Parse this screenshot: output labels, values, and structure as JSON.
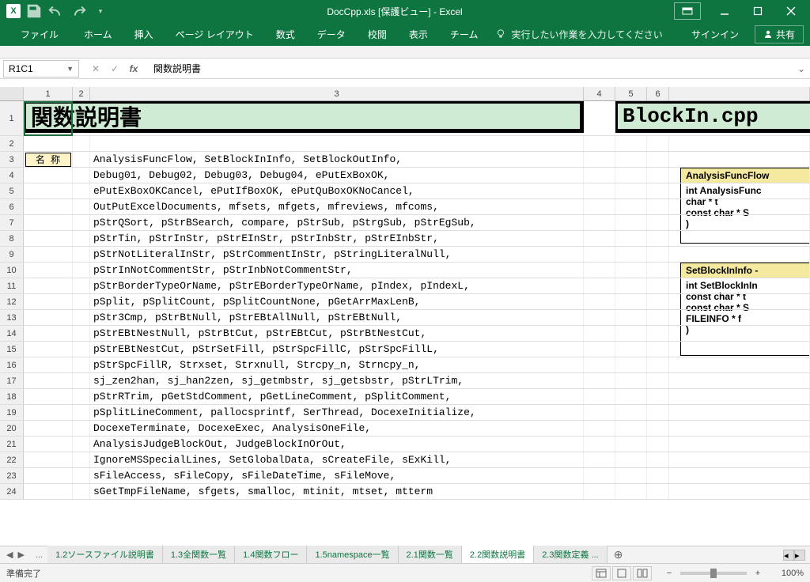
{
  "titlebar": {
    "app_icon_letter": "X",
    "title": "DocCpp.xls  [保護ビュー] - Excel"
  },
  "ribbon": {
    "tabs": [
      "ファイル",
      "ホーム",
      "挿入",
      "ページ レイアウト",
      "数式",
      "データ",
      "校閲",
      "表示",
      "チーム"
    ],
    "tellme": "実行したい作業を入力してください",
    "signin": "サインイン",
    "share": "共有"
  },
  "formula_bar": {
    "name_box": "R1C1",
    "formula": "関数説明書"
  },
  "columns": [
    "1",
    "2",
    "3",
    "4",
    "5",
    "6"
  ],
  "banner1": "関数説明書",
  "banner2": "BlockIn.cpp",
  "label_name": "名 称",
  "rows": [
    "AnalysisFuncFlow, SetBlockInInfo, SetBlockOutInfo,",
    "Debug01, Debug02, Debug03, Debug04, ePutExBoxOK,",
    "ePutExBoxOKCancel, ePutIfBoxOK, ePutQuBoxOKNoCancel,",
    "OutPutExcelDocuments, mfsets, mfgets, mfreviews, mfcoms,",
    "pStrQSort, pStrBSearch, compare, pStrSub, pStrgSub, pStrEgSub,",
    "pStrTin, pStrInStr, pStrEInStr, pStrInbStr, pStrEInbStr,",
    "pStrNotLiteralInStr, pStrCommentInStr, pStringLiteralNull,",
    "pStrInNotCommentStr, pStrInbNotCommentStr,",
    "pStrBorderTypeOrName, pStrEBorderTypeOrName, pIndex, pIndexL,",
    "pSplit, pSplitCount, pSplitCountNone, pGetArrMaxLenB,",
    "pStr3Cmp, pStrBtNull, pStrEBtAllNull, pStrEBtNull,",
    "pStrEBtNestNull, pStrBtCut, pStrEBtCut, pStrBtNestCut,",
    "pStrEBtNestCut, pStrSetFill, pStrSpcFillC, pStrSpcFillL,",
    "pStrSpcFillR, Strxset, Strxnull, Strcpy_n, Strncpy_n,",
    "sj_zen2han, sj_han2zen, sj_getmbstr, sj_getsbstr, pStrLTrim,",
    "pStrRTrim, pGetStdComment, pGetLineComment, pSplitComment,",
    "pSplitLineComment, pallocsprintf, SerThread, DocexeInitialize,",
    "DocexeTerminate, DocexeExec, AnalysisOneFile,",
    "AnalysisJudgeBlockOut, JudgeBlockInOrOut,",
    "IgnoreMSSpecialLines, SetGlobalData, sCreateFile, sExKill,",
    "sFileAccess, sFileCopy, sFileDateTime, sFileMove,",
    "sGetTmpFileName, sfgets, smalloc, mtinit, mtset, mtterm"
  ],
  "code_block1": {
    "header": "AnalysisFuncFlow",
    "lines": [
      "int AnalysisFunc",
      "  char *        t",
      "  const char * S",
      ")"
    ]
  },
  "code_block2": {
    "header": "SetBlockInInfo -",
    "lines": [
      "int SetBlockInIn",
      "  const char * t",
      "  const char * S",
      "  FILEINFO *   f",
      ")"
    ]
  },
  "sheet_tabs": {
    "tabs": [
      "1.2ソースファイル説明書",
      "1.3全関数一覧",
      "1.4関数フロー",
      "1.5namespace一覧",
      "2.1関数一覧",
      "2.2関数説明書",
      "2.3関数定義 ..."
    ],
    "active_index": 5
  },
  "statusbar": {
    "ready": "準備完了",
    "zoom": "100%"
  }
}
